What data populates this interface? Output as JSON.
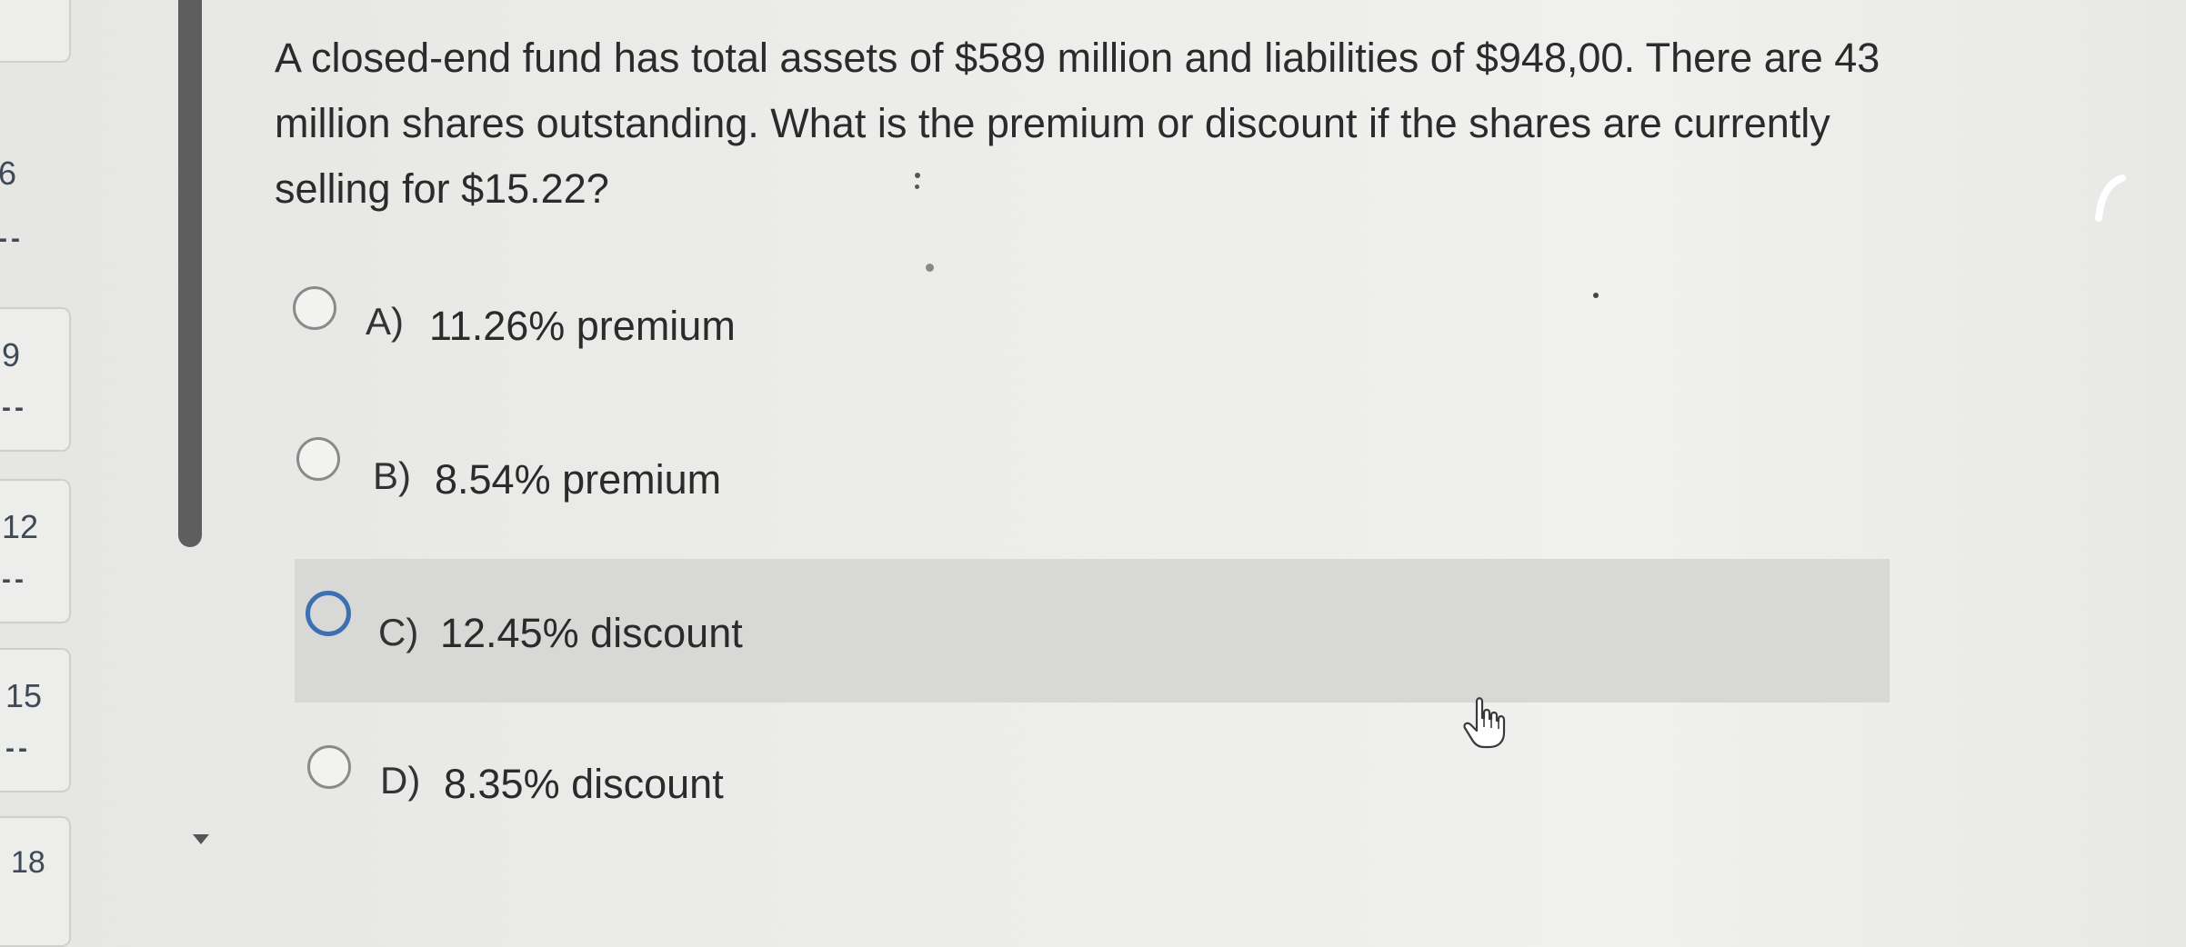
{
  "question": {
    "text": "A closed-end fund has total assets of $589 million and liabilities of $948,00. There are 43 million shares outstanding. What is the premium or discount if the shares are currently selling for $15.22?"
  },
  "options": [
    {
      "letter": "A)",
      "text": "11.26% premium",
      "selected": false,
      "hovered": false
    },
    {
      "letter": "B)",
      "text": "8.54% premium",
      "selected": false,
      "hovered": false
    },
    {
      "letter": "C)",
      "text": "12.45% discount",
      "selected": false,
      "hovered": true
    },
    {
      "letter": "D)",
      "text": "8.35% discount",
      "selected": false,
      "hovered": false
    }
  ],
  "navigator": {
    "items": [
      {
        "number": "6",
        "status": "--"
      },
      {
        "number": "9",
        "status": "--"
      },
      {
        "number": "12",
        "status": "--"
      },
      {
        "number": "15",
        "status": "--"
      },
      {
        "number": "18",
        "status": ""
      }
    ]
  },
  "colors": {
    "hover_row": "#d8d8d6",
    "radio_accent": "#3d6fb3",
    "scrollbar": "#5e5e5e"
  },
  "icons": {
    "cursor": "hand-pointer-icon",
    "scroll_down": "scroll-down-arrow-icon"
  }
}
